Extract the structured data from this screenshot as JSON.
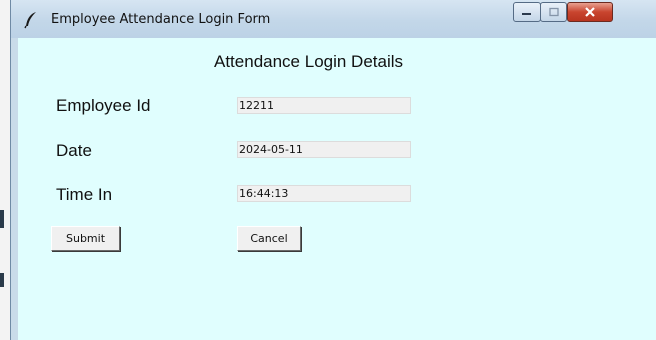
{
  "window": {
    "title": "Employee Attendance Login Form",
    "icon": "feather-icon"
  },
  "form": {
    "heading": "Attendance Login  Details",
    "fields": [
      {
        "label": "Employee Id",
        "value": "12211"
      },
      {
        "label": "Date",
        "value": "2024-05-11"
      },
      {
        "label": "Time In",
        "value": "16:44:13"
      }
    ],
    "buttons": {
      "submit": "Submit",
      "cancel": "Cancel"
    }
  },
  "colors": {
    "client_background": "#e0fefe",
    "close_button": "#c9452f"
  }
}
